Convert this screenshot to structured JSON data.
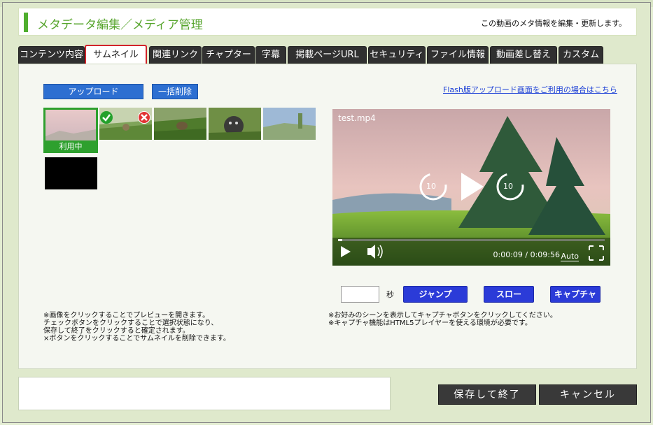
{
  "header": {
    "title": "メタデータ編集／メディア管理",
    "description": "この動画のメタ情報を編集・更新します。"
  },
  "tabs": [
    {
      "label": "コンテンツ内容"
    },
    {
      "label": "サムネイル",
      "active": true
    },
    {
      "label": "関連リンク"
    },
    {
      "label": "チャプター"
    },
    {
      "label": "字幕"
    },
    {
      "label": "掲載ページURL"
    },
    {
      "label": "セキュリティ"
    },
    {
      "label": "ファイル情報"
    },
    {
      "label": "動画差し替え"
    },
    {
      "label": "カスタム"
    }
  ],
  "thumbnails": {
    "upload_label": "アップロード",
    "bulk_delete_label": "一括削除",
    "in_use_label": "利用中",
    "note": "※画像をクリックすることでプレビューを開きます。\nチェックボタンをクリックすることで選択状態になり、\n保存して終了をクリックすると確定されます。\n×ボタンをクリックすることでサムネイルを削除できます。"
  },
  "flash_link": "Flash版アップロード画面をご利用の場合はこちら",
  "player": {
    "filename": "test.mp4",
    "skip_back": "10",
    "skip_forward": "10",
    "time": "0:00:09 / 0:09:56",
    "quality": "Auto",
    "progress": 0.016
  },
  "capture": {
    "seconds_value": "",
    "seconds_unit": "秒",
    "jump_label": "ジャンプ",
    "slow_label": "スロー",
    "capture_label": "キャプチャ",
    "note": "※お好みのシーンを表示してキャプチャボタンをクリックしてください。\n※キャプチャ機能はHTML5プレイヤーを使える環境が必要です。"
  },
  "footer": {
    "save_label": "保存して終了",
    "cancel_label": "キャンセル"
  },
  "colors": {
    "accent_green": "#4fae2e",
    "tab_dark": "#303030",
    "active_tab_border": "#d2232a",
    "button_blue": "#2d6fd1",
    "button_indigo": "#2b3bd8"
  }
}
